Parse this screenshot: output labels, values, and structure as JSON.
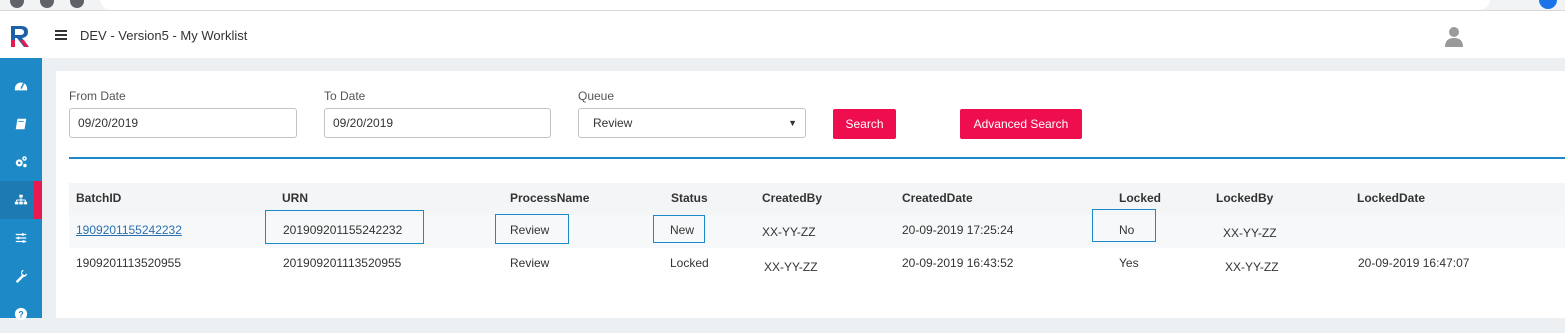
{
  "app": {
    "title": "DEV - Version5 - My Worklist"
  },
  "sidebar": {
    "items": [
      {
        "icon": "dashboard-icon"
      },
      {
        "icon": "book-icon"
      },
      {
        "icon": "cogs-icon"
      },
      {
        "icon": "sitemap-icon",
        "active": true
      },
      {
        "icon": "sliders-icon"
      },
      {
        "icon": "wrench-icon"
      },
      {
        "icon": "help-icon"
      }
    ]
  },
  "filters": {
    "from_date_label": "From Date",
    "from_date_value": "09/20/2019",
    "to_date_label": "To Date",
    "to_date_value": "09/20/2019",
    "queue_label": "Queue",
    "queue_value": "Review",
    "search_label": "Search",
    "advanced_search_label": "Advanced Search"
  },
  "table": {
    "headers": [
      "BatchID",
      "URN",
      "ProcessName",
      "Status",
      "CreatedBy",
      "CreatedDate",
      "Locked",
      "LockedBy",
      "LockedDate"
    ],
    "rows": [
      [
        "1909201155242232",
        "201909201155242232",
        "Review",
        "New",
        "XX-YY-ZZ",
        "20-09-2019 17:25:24",
        "No",
        "XX-YY-ZZ",
        ""
      ],
      [
        "1909201113520955",
        "201909201113520955",
        "Review",
        "Locked",
        "XX-YY-ZZ",
        "20-09-2019 16:43:52",
        "Yes",
        "XX-YY-ZZ",
        "20-09-2019 16:47:07"
      ]
    ]
  },
  "colors": {
    "accent_blue": "#1d89c7",
    "button_pink": "#ee0d4f",
    "link_blue": "#2a6fb0"
  }
}
